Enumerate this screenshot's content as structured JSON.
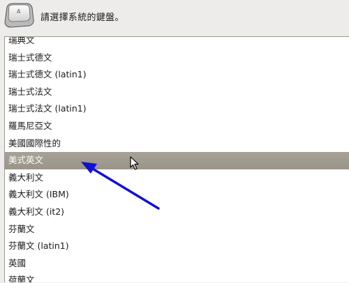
{
  "header": {
    "prompt": "請選擇系統的鍵盤。",
    "icon": "keyboard-key-icon"
  },
  "keyboard_list": {
    "items": [
      {
        "label": "瑞典文",
        "selected": false
      },
      {
        "label": "瑞士式德文",
        "selected": false
      },
      {
        "label": "瑞士式德文 (latin1)",
        "selected": false
      },
      {
        "label": "瑞士式法文",
        "selected": false
      },
      {
        "label": "瑞士式法文 (latin1)",
        "selected": false
      },
      {
        "label": "羅馬尼亞文",
        "selected": false
      },
      {
        "label": "美國國際性的",
        "selected": false
      },
      {
        "label": "美式英文",
        "selected": true
      },
      {
        "label": "義大利文",
        "selected": false
      },
      {
        "label": "義大利文 (IBM)",
        "selected": false
      },
      {
        "label": "義大利文 (it2)",
        "selected": false
      },
      {
        "label": "芬蘭文",
        "selected": false
      },
      {
        "label": "芬蘭文 (latin1)",
        "selected": false
      },
      {
        "label": "英國",
        "selected": false
      },
      {
        "label": "荷蘭文",
        "selected": false
      }
    ]
  },
  "annotation": {
    "color": "#1010d8",
    "icon": "pointer-arrow-annotation"
  },
  "colors": {
    "background": "#edeceb",
    "selection": "#a19c90",
    "list_background": "#ffffff"
  }
}
